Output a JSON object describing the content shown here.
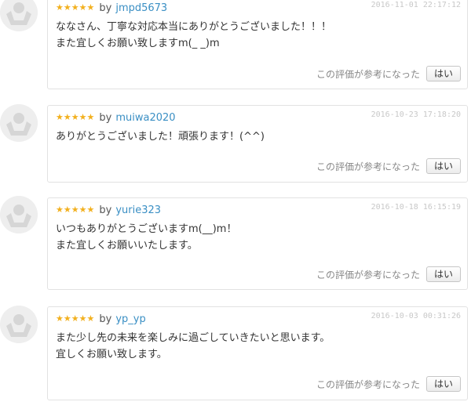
{
  "common": {
    "by_label": "by",
    "helpful_text": "この評価が参考になった",
    "yes_button": "はい"
  },
  "reviews": [
    {
      "rating": 5,
      "username": "jmpd5673",
      "date": "2016-11-01 22:17:12",
      "lines": [
        "ななさん、丁寧な対応本当にありがとうございました！！！",
        "また宜しくお願い致しますm(_ _)m"
      ]
    },
    {
      "rating": 5,
      "username": "muiwa2020",
      "date": "2016-10-23 17:18:20",
      "lines": [
        "ありがとうございました！頑張ります！(^^)",
        ""
      ]
    },
    {
      "rating": 5,
      "username": "yurie323",
      "date": "2016-10-18 16:15:19",
      "lines": [
        "いつもありがとうございますm(__)m！",
        "また宜しくお願いいたします。"
      ]
    },
    {
      "rating": 5,
      "username": "yp_yp",
      "date": "2016-10-03 00:31:26",
      "lines": [
        "また少し先の未来を楽しみに過ごしていきたいと思います。",
        "宜しくお願い致します。"
      ]
    }
  ]
}
